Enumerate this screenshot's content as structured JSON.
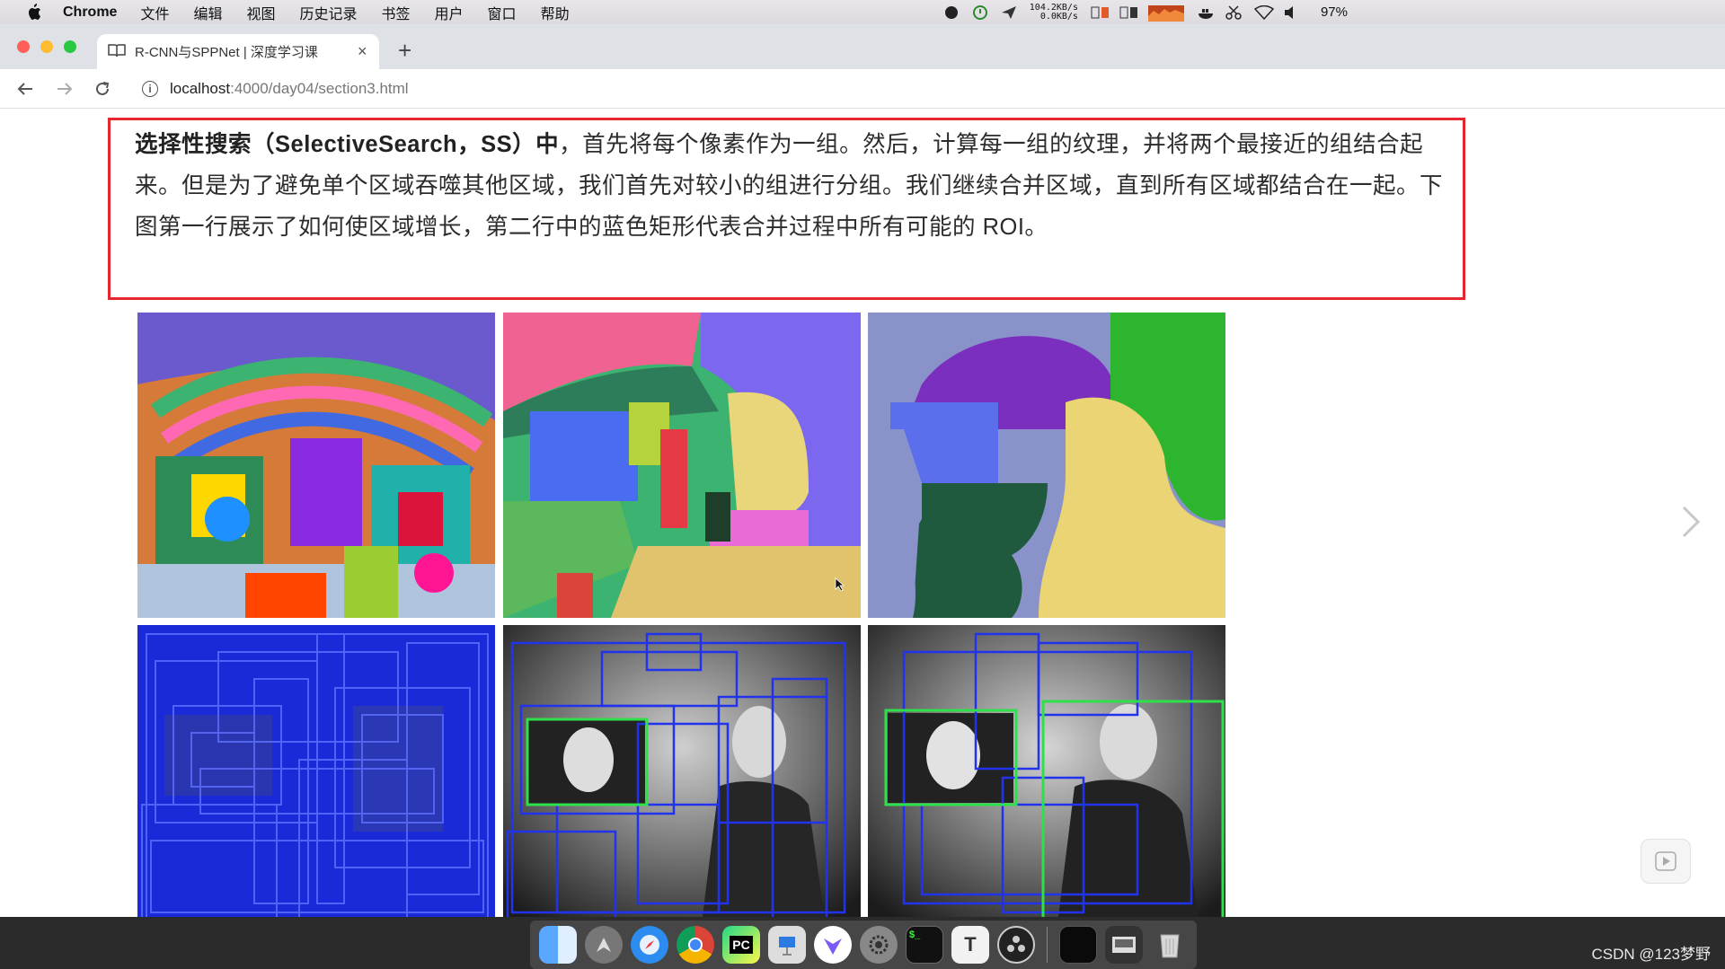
{
  "menubar": {
    "app_name": "Chrome",
    "items": [
      "文件",
      "编辑",
      "视图",
      "历史记录",
      "书签",
      "用户",
      "窗口",
      "帮助"
    ],
    "net_up": "104.2KB/s",
    "net_down": "0.0KB/s",
    "battery": "97%"
  },
  "browser": {
    "tab_title": "R-CNN与SPPNet | 深度学习课",
    "url_host": "localhost",
    "url_path": ":4000/day04/section3.html"
  },
  "content": {
    "para_bold": "选择性搜索（SelectiveSearch，SS）中",
    "para_text": "，首先将每个像素作为一组。然后，计算每一组的纹理，并将两个最接近的组结合起来。但是为了避免单个区域吞噬其他区域，我们首先对较小的组进行分组。我们继续合并区域，直到所有区域都结合在一起。下图第一行展示了如何使区域增长，第二行中的蓝色矩形代表合并过程中所有可能的 ROI。",
    "highlight_color": "#e8262e"
  },
  "watermark": "CSDN @123梦野",
  "dock": {
    "apps": [
      "finder",
      "launchpad",
      "safari",
      "chrome",
      "pycharm",
      "keynote",
      "vpn",
      "system-preferences",
      "terminal",
      "typora",
      "obs",
      "black-window",
      "screenshot",
      "trash"
    ]
  }
}
